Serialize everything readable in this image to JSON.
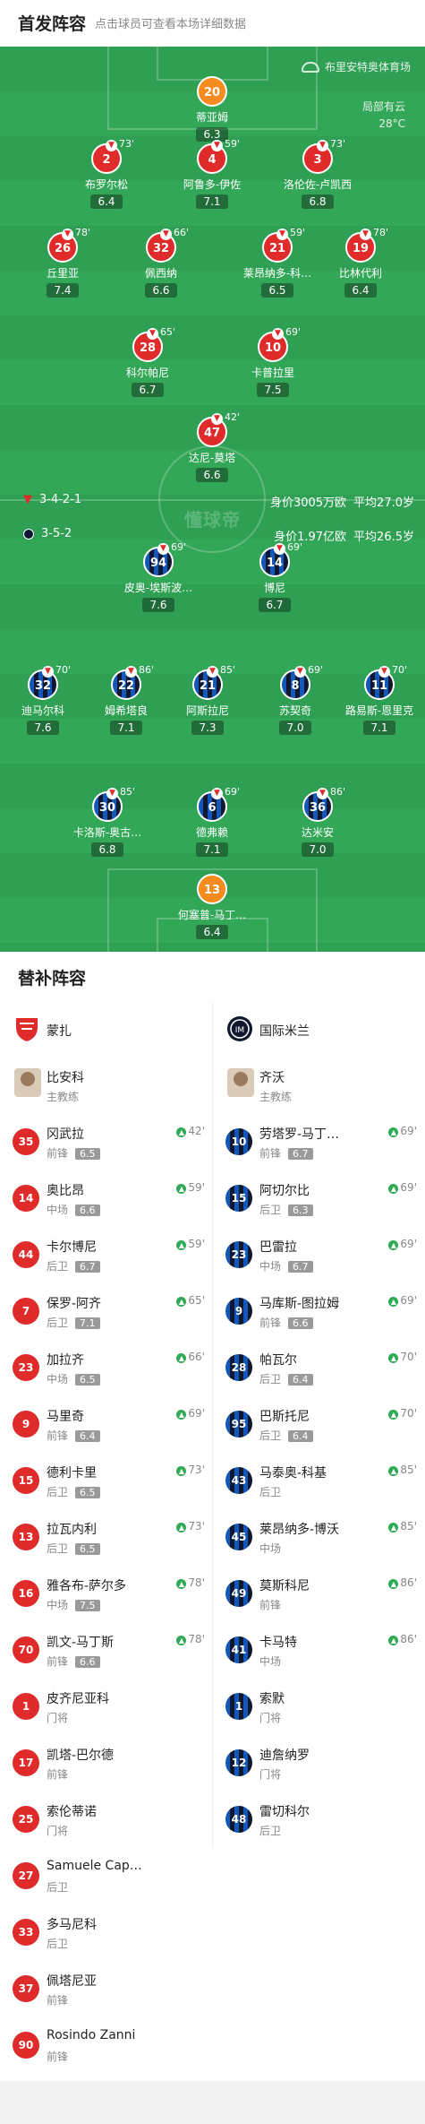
{
  "header": {
    "title": "首发阵容",
    "subtitle": "点击球员可查看本场详细数据"
  },
  "venue": "布里安特奥体育场",
  "weather": {
    "condition": "局部有云",
    "temp": "28°C"
  },
  "watermark": "懂球帝",
  "monza": {
    "formation": "3-4-2-1",
    "value": "身价3005万欧",
    "age": "平均27.0岁"
  },
  "inter": {
    "formation": "3-5-2",
    "value": "身价1.97亿欧",
    "age": "平均26.5岁"
  },
  "pitch_players": [
    {
      "team": "gk",
      "num": "20",
      "name": "蒂亚姆",
      "rating": "6.3",
      "sub": ""
    },
    {
      "team": "m",
      "num": "2",
      "name": "布罗尔松",
      "rating": "6.4",
      "sub": "73'"
    },
    {
      "team": "m",
      "num": "4",
      "name": "阿鲁多-伊佐",
      "rating": "7.1",
      "sub": "59'"
    },
    {
      "team": "m",
      "num": "3",
      "name": "洛伦佐-卢凯西",
      "rating": "6.8",
      "sub": "73'"
    },
    {
      "team": "m",
      "num": "26",
      "name": "丘里亚",
      "rating": "7.4",
      "sub": "78'"
    },
    {
      "team": "m",
      "num": "32",
      "name": "佩西纳",
      "rating": "6.6",
      "sub": "66'"
    },
    {
      "team": "m",
      "num": "21",
      "name": "莱昂纳多-科…",
      "rating": "6.5",
      "sub": "59'"
    },
    {
      "team": "m",
      "num": "19",
      "name": "比林代利",
      "rating": "6.4",
      "sub": "78'"
    },
    {
      "team": "m",
      "num": "28",
      "name": "科尔帕尼",
      "rating": "6.7",
      "sub": "65'"
    },
    {
      "team": "m",
      "num": "10",
      "name": "卡普拉里",
      "rating": "7.5",
      "sub": "69'"
    },
    {
      "team": "m",
      "num": "47",
      "name": "达尼-莫塔",
      "rating": "6.6",
      "sub": "42'"
    },
    {
      "team": "i",
      "num": "94",
      "name": "皮奥-埃斯波…",
      "rating": "7.6",
      "sub": "69'"
    },
    {
      "team": "i",
      "num": "14",
      "name": "博尼",
      "rating": "6.7",
      "sub": "69'"
    },
    {
      "team": "i",
      "num": "32",
      "name": "迪马尔科",
      "rating": "7.6",
      "sub": "70'"
    },
    {
      "team": "i",
      "num": "22",
      "name": "姆希塔良",
      "rating": "7.1",
      "sub": "86'"
    },
    {
      "team": "i",
      "num": "21",
      "name": "阿斯拉尼",
      "rating": "7.3",
      "sub": "85'"
    },
    {
      "team": "i",
      "num": "8",
      "name": "苏契奇",
      "rating": "7.0",
      "sub": "69'"
    },
    {
      "team": "i",
      "num": "11",
      "name": "路易斯-恩里克",
      "rating": "7.1",
      "sub": "70'"
    },
    {
      "team": "i",
      "num": "30",
      "name": "卡洛斯-奥古…",
      "rating": "6.8",
      "sub": "85'"
    },
    {
      "team": "i",
      "num": "6",
      "name": "德弗赖",
      "rating": "7.1",
      "sub": "69'"
    },
    {
      "team": "i",
      "num": "36",
      "name": "达米安",
      "rating": "7.0",
      "sub": "86'"
    },
    {
      "team": "gk",
      "num": "13",
      "name": "何塞普-马丁…",
      "rating": "6.4",
      "sub": ""
    }
  ],
  "bench": {
    "title": "替补阵容",
    "left_team": "蒙扎",
    "right_team": "国际米兰",
    "left_coach": {
      "name": "比安科",
      "role": "主教练"
    },
    "right_coach": {
      "name": "齐沃",
      "role": "主教练"
    },
    "left": [
      {
        "num": "35",
        "name": "冈武拉",
        "pos": "前锋",
        "rating": "6.5",
        "in": "42'"
      },
      {
        "num": "14",
        "name": "奥比昂",
        "pos": "中场",
        "rating": "6.6",
        "in": "59'"
      },
      {
        "num": "44",
        "name": "卡尔博尼",
        "pos": "后卫",
        "rating": "6.7",
        "in": "59'"
      },
      {
        "num": "7",
        "name": "保罗-阿齐",
        "pos": "后卫",
        "rating": "7.1",
        "in": "65'"
      },
      {
        "num": "23",
        "name": "加拉齐",
        "pos": "中场",
        "rating": "6.5",
        "in": "66'"
      },
      {
        "num": "9",
        "name": "马里奇",
        "pos": "前锋",
        "rating": "6.4",
        "in": "69'"
      },
      {
        "num": "15",
        "name": "德利卡里",
        "pos": "后卫",
        "rating": "6.5",
        "in": "73'"
      },
      {
        "num": "13",
        "name": "拉瓦内利",
        "pos": "后卫",
        "rating": "6.5",
        "in": "73'"
      },
      {
        "num": "16",
        "name": "雅各布-萨尔多",
        "pos": "中场",
        "rating": "7.5",
        "in": "78'"
      },
      {
        "num": "70",
        "name": "凯文-马丁斯",
        "pos": "前锋",
        "rating": "6.6",
        "in": "78'"
      },
      {
        "num": "1",
        "name": "皮齐尼亚科",
        "pos": "门将",
        "rating": "",
        "in": ""
      },
      {
        "num": "17",
        "name": "凯塔-巴尔德",
        "pos": "前锋",
        "rating": "",
        "in": ""
      },
      {
        "num": "25",
        "name": "索伦蒂诺",
        "pos": "门将",
        "rating": "",
        "in": ""
      },
      {
        "num": "27",
        "name": "Samuele Cap…",
        "pos": "后卫",
        "rating": "",
        "in": ""
      },
      {
        "num": "33",
        "name": "多马尼科",
        "pos": "后卫",
        "rating": "",
        "in": ""
      },
      {
        "num": "37",
        "name": "佩塔尼亚",
        "pos": "前锋",
        "rating": "",
        "in": ""
      },
      {
        "num": "90",
        "name": "Rosindo Zanni",
        "pos": "前锋",
        "rating": "",
        "in": ""
      }
    ],
    "right": [
      {
        "num": "10",
        "name": "劳塔罗-马丁…",
        "pos": "前锋",
        "rating": "6.7",
        "in": "69'"
      },
      {
        "num": "15",
        "name": "阿切尔比",
        "pos": "后卫",
        "rating": "6.3",
        "in": "69'"
      },
      {
        "num": "23",
        "name": "巴雷拉",
        "pos": "中场",
        "rating": "6.7",
        "in": "69'"
      },
      {
        "num": "9",
        "name": "马库斯-图拉姆",
        "pos": "前锋",
        "rating": "6.6",
        "in": "69'"
      },
      {
        "num": "28",
        "name": "帕瓦尔",
        "pos": "后卫",
        "rating": "6.4",
        "in": "70'"
      },
      {
        "num": "95",
        "name": "巴斯托尼",
        "pos": "后卫",
        "rating": "6.4",
        "in": "70'"
      },
      {
        "num": "43",
        "name": "马泰奥-科基",
        "pos": "后卫",
        "rating": "",
        "in": "85'"
      },
      {
        "num": "45",
        "name": "莱昂纳多-博沃",
        "pos": "中场",
        "rating": "",
        "in": "85'"
      },
      {
        "num": "49",
        "name": "莫斯科尼",
        "pos": "前锋",
        "rating": "",
        "in": "86'"
      },
      {
        "num": "41",
        "name": "卡马特",
        "pos": "中场",
        "rating": "",
        "in": "86'"
      },
      {
        "num": "1",
        "name": "索默",
        "pos": "门将",
        "rating": "",
        "in": ""
      },
      {
        "num": "12",
        "name": "迪詹纳罗",
        "pos": "门将",
        "rating": "",
        "in": ""
      },
      {
        "num": "48",
        "name": "雷切科尔",
        "pos": "后卫",
        "rating": "",
        "in": ""
      }
    ]
  }
}
